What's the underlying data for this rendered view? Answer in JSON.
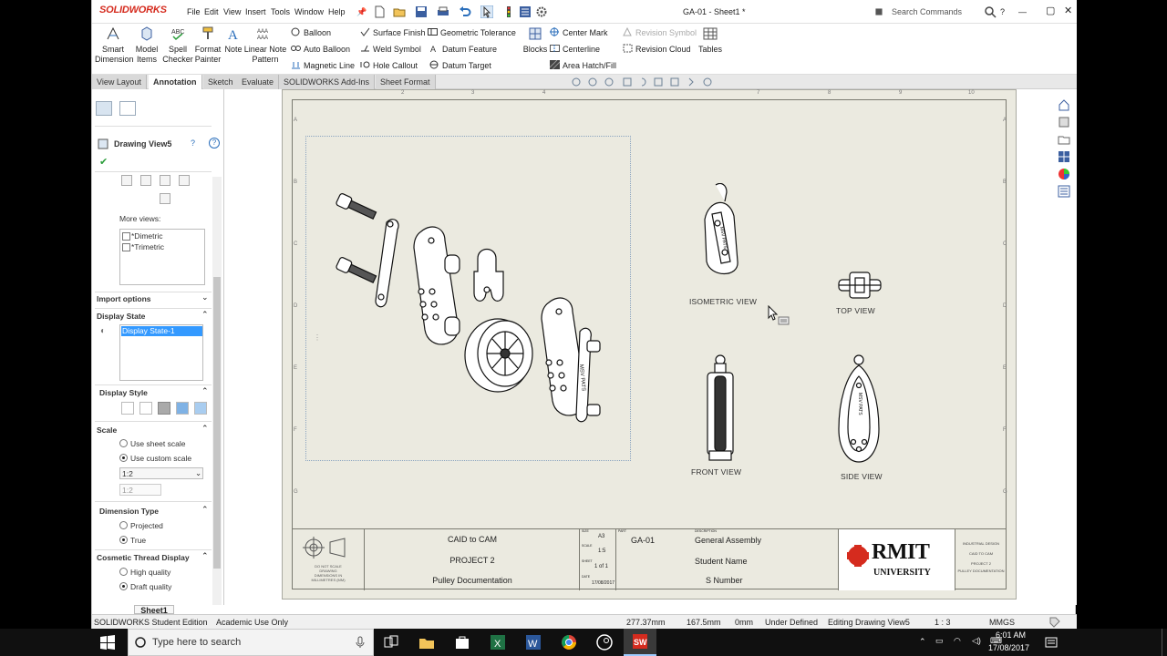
{
  "titlebar": {
    "logo": "SOLIDWORKS",
    "menus": [
      "File",
      "Edit",
      "View",
      "Insert",
      "Tools",
      "Window",
      "Help"
    ],
    "doc_title": "GA-01 - Sheet1 *",
    "search_placeholder": "Search Commands"
  },
  "ribbon": {
    "smart_dimension": "Smart Dimension",
    "model_items": "Model Items",
    "spell_checker": "Spell Checker",
    "format_painter": "Format Painter",
    "note": "Note",
    "linear_note_pattern": "Linear Note Pattern",
    "balloon": "Balloon",
    "auto_balloon": "Auto Balloon",
    "magnetic_line": "Magnetic Line",
    "surface_finish": "Surface Finish",
    "weld_symbol": "Weld Symbol",
    "hole_callout": "Hole Callout",
    "geometric_tolerance": "Geometric Tolerance",
    "datum_feature": "Datum Feature",
    "datum_target": "Datum Target",
    "blocks": "Blocks",
    "center_mark": "Center Mark",
    "centerline": "Centerline",
    "area_hatch": "Area Hatch/Fill",
    "revision_symbol": "Revision Symbol",
    "revision_cloud": "Revision Cloud",
    "tables": "Tables"
  },
  "tabs": [
    "View Layout",
    "Annotation",
    "Sketch",
    "Evaluate",
    "SOLIDWORKS Add-Ins",
    "Sheet Format"
  ],
  "active_tab": "Annotation",
  "panel": {
    "title": "Drawing View5",
    "more_views_label": "More views:",
    "more_views": [
      "*Dimetric",
      "*Trimetric"
    ],
    "import_options": "Import options",
    "display_state_header": "Display State",
    "display_state_item": "Display State-1",
    "display_style_header": "Display Style",
    "scale_header": "Scale",
    "use_sheet_scale": "Use sheet scale",
    "use_custom_scale": "Use custom scale",
    "scale_select": "1:2",
    "scale_input": "1:2",
    "dimension_type_header": "Dimension Type",
    "projected": "Projected",
    "true_label": "True",
    "cosmetic_thread_header": "Cosmetic Thread Display",
    "high_quality": "High quality",
    "draft_quality": "Draft quality",
    "sheet_tab": "Sheet1"
  },
  "drawing": {
    "col_labels": [
      "1",
      "2",
      "3",
      "4",
      "5",
      "6",
      "7",
      "8",
      "9",
      "10"
    ],
    "row_labels": [
      "A",
      "B",
      "C",
      "D",
      "E",
      "F",
      "G"
    ],
    "views": {
      "isometric": "ISOMETRIC VIEW",
      "top": "TOP VIEW",
      "front": "FRONT VIEW",
      "side": "SIDE VIEW"
    },
    "title_block": {
      "course": "CAID to CAM",
      "project": "PROJECT 2",
      "doc": "Pulley Documentation",
      "size_label": "SIZE",
      "size": "A3",
      "scale_label": "SCALE",
      "scale": "1:5",
      "sheet_label": "SHEET",
      "sheet": "1 of 1",
      "date_label": "DATE",
      "date": "17/08/2017",
      "part_label": "PART",
      "part": "GA-01",
      "description_label": "DESCRIPTION",
      "description": "General Assembly",
      "student_name": "Student Name",
      "s_number": "S Number",
      "dns_note": "DO NOT SCALE DRAWING DIMENSIONS IN MILLIMETRES (MM)",
      "rmit": "RMIT",
      "university": "UNIVERSITY",
      "right_notes": [
        "INDUSTRIAL DESIGN",
        "CAID TO CAM",
        "PROJECT 2",
        "PULLEY DOCUMENTATION"
      ]
    }
  },
  "status": {
    "edition": "SOLIDWORKS Student Edition",
    "use": "Academic Use Only",
    "x": "277.37mm",
    "y": "167.5mm",
    "z": "0mm",
    "state": "Under Defined",
    "editing": "Editing Drawing View5",
    "scale": "1 : 3",
    "units": "MMGS"
  },
  "taskbar": {
    "search_placeholder": "Type here to search",
    "time": "6:01 AM",
    "date": "17/08/2017"
  },
  "colors": {
    "accent": "#d52b1e",
    "sheet": "#ebeae0",
    "selection": "#3399ff"
  }
}
